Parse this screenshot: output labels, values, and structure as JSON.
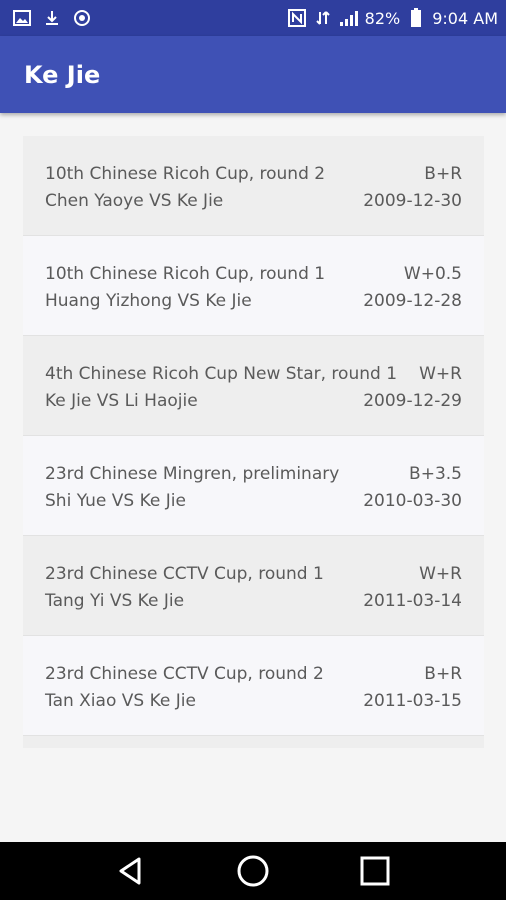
{
  "status_bar": {
    "battery": "82%",
    "time": "9:04 AM",
    "icons_left": [
      "image-icon",
      "download-icon",
      "sync-icon"
    ],
    "icons_right": [
      "nfc-icon",
      "data-icon",
      "signal-icon",
      "battery-icon"
    ]
  },
  "app_bar": {
    "title": "Ke Jie",
    "color": "#3f51b5"
  },
  "games": [
    {
      "event": "10th Chinese Ricoh Cup, round 2",
      "result": "B+R",
      "players": "Chen Yaoye VS Ke Jie",
      "date": "2009-12-30"
    },
    {
      "event": "10th Chinese Ricoh Cup, round 1",
      "result": "W+0.5",
      "players": "Huang Yizhong VS Ke Jie",
      "date": "2009-12-28"
    },
    {
      "event": "4th Chinese Ricoh Cup New Star, round 1",
      "result": "W+R",
      "players": "Ke Jie VS Li Haojie",
      "date": "2009-12-29"
    },
    {
      "event": "23rd Chinese Mingren, preliminary",
      "result": "B+3.5",
      "players": "Shi Yue VS Ke Jie",
      "date": "2010-03-30"
    },
    {
      "event": "23rd Chinese CCTV Cup, round 1",
      "result": "W+R",
      "players": "Tang Yi VS Ke Jie",
      "date": "2011-03-14"
    },
    {
      "event": "23rd Chinese CCTV Cup, round 2",
      "result": "B+R",
      "players": "Tan Xiao VS Ke Jie",
      "date": "2011-03-15"
    }
  ],
  "nav_bar": {
    "buttons": [
      "back-icon",
      "home-icon",
      "recents-icon"
    ]
  }
}
